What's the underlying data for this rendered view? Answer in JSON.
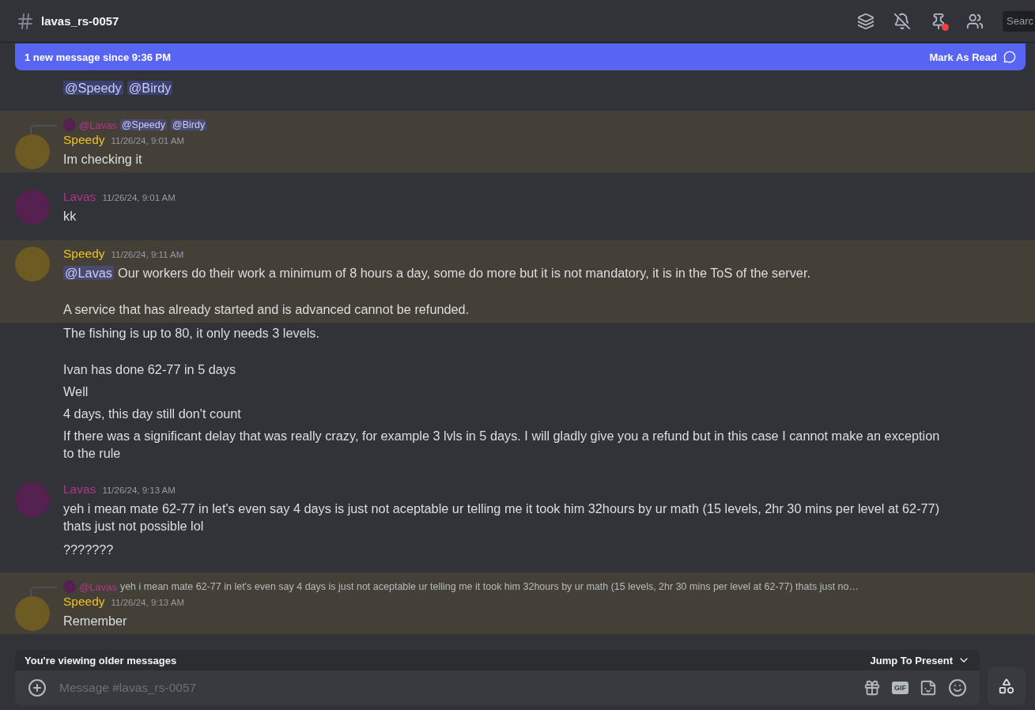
{
  "channel": {
    "name": "lavas_rs-0057",
    "pins_unread": true,
    "search_placeholder": "Searc"
  },
  "banner": {
    "text": "1 new message since 9:36 PM",
    "action": "Mark As Read"
  },
  "messages": [
    {
      "highlighted": false,
      "paragraphs": [
        [
          {
            "kind": "mention",
            "text": "@Speedy"
          },
          {
            "kind": "mention",
            "text": "@Birdy"
          }
        ]
      ]
    },
    {
      "author": "Speedy",
      "color": "#f0c419",
      "time": "11/26/24, 9:01 AM",
      "highlighted": true,
      "reply": {
        "author": "@Lavas",
        "color": "#b5338a",
        "segments": [
          {
            "kind": "mention",
            "text": "@Speedy"
          },
          {
            "kind": "mention",
            "text": "@Birdy"
          }
        ]
      },
      "paragraphs": [
        [
          {
            "kind": "text",
            "text": "Im checking it"
          }
        ]
      ]
    },
    {
      "author": "Lavas",
      "color": "#b5338a",
      "time": "11/26/24, 9:01 AM",
      "highlighted": false,
      "paragraphs": [
        [
          {
            "kind": "text",
            "text": "kk"
          }
        ]
      ]
    },
    {
      "author": "Speedy",
      "color": "#f0c419",
      "time": "11/26/24, 9:11 AM",
      "highlighted": true,
      "paragraphs": [
        [
          {
            "kind": "mention",
            "text": "@Lavas"
          },
          {
            "kind": "text",
            "text": "Our workers do their work a minimum of 8 hours a day, some do more but it is not mandatory, it is in the ToS of the server."
          }
        ],
        [
          {
            "kind": "text",
            "text": "A service that has already started and is advanced cannot be refunded."
          }
        ]
      ]
    },
    {
      "highlighted": false,
      "paragraphs": [
        [
          {
            "kind": "text",
            "text": "The fishing is up to 80, it only needs 3 levels."
          }
        ],
        [
          {
            "kind": "text",
            "text": "Ivan has done 62-77 in 5 days"
          }
        ]
      ]
    },
    {
      "highlighted": false,
      "paragraphs": [
        [
          {
            "kind": "text",
            "text": "Well"
          }
        ]
      ]
    },
    {
      "highlighted": false,
      "paragraphs": [
        [
          {
            "kind": "text",
            "text": "4 days, this day still don't count"
          }
        ]
      ]
    },
    {
      "highlighted": false,
      "paragraphs": [
        [
          {
            "kind": "text",
            "text": "If there was a significant delay that was really crazy, for example 3 lvls in 5 days. I will gladly give you a refund but in this case I cannot make an exception to the rule"
          }
        ]
      ]
    },
    {
      "author": "Lavas",
      "color": "#b5338a",
      "time": "11/26/24, 9:13 AM",
      "highlighted": false,
      "paragraphs": [
        [
          {
            "kind": "text",
            "text": "yeh i mean mate 62-77 in let's even say 4 days is just not aceptable ur telling me it took him 32hours by ur math (15 levels, 2hr 30 mins per level at 62-77) thats just not possible lol"
          }
        ]
      ]
    },
    {
      "highlighted": false,
      "paragraphs": [
        [
          {
            "kind": "text",
            "text": "???????"
          }
        ]
      ]
    },
    {
      "author": "Speedy",
      "color": "#f0c419",
      "time": "11/26/24, 9:13 AM",
      "highlighted": true,
      "reply": {
        "author": "@Lavas",
        "color": "#b5338a",
        "segments": [
          {
            "kind": "text",
            "text": "yeh i mean mate 62-77 in let's even say 4 days is just not aceptable ur telling me it took him 32hours by ur math (15 levels, 2hr 30 mins per level at 62-77) thats just no…"
          }
        ]
      },
      "paragraphs": [
        [
          {
            "kind": "text",
            "text": "Remember"
          }
        ]
      ]
    }
  ],
  "older_bar": {
    "text": "You're viewing older messages",
    "action": "Jump To Present"
  },
  "composer": {
    "placeholder": "Message #lavas_rs-0057",
    "gif_label": "GIF"
  }
}
